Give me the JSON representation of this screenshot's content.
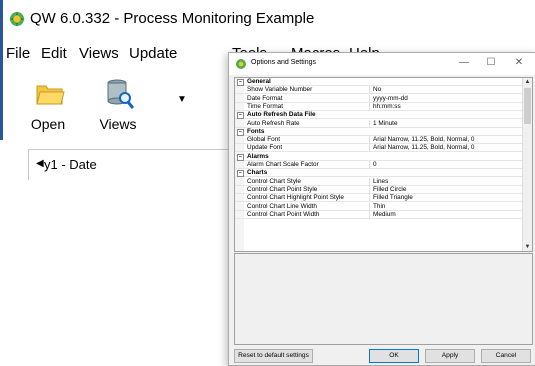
{
  "app": {
    "title": "QW 6.0.332 - Process Monitoring Example",
    "menu": [
      "File",
      "Edit",
      "Views",
      "Update",
      "Tools",
      "Macros",
      "Help"
    ],
    "ribbon": {
      "open_label": "Open",
      "views_label": "Views"
    },
    "tree": {
      "item_label": "y1 - Date"
    }
  },
  "dialog": {
    "title": "Options and Settings",
    "window_controls": {
      "minimize": "—",
      "maximize": "☐",
      "close": "✕"
    },
    "rows": [
      {
        "type": "category",
        "name": "General"
      },
      {
        "type": "property",
        "name": "Show Variable Number",
        "value": "No"
      },
      {
        "type": "property",
        "name": "Date Format",
        "value": "yyyy-mm-dd"
      },
      {
        "type": "property",
        "name": "Time Format",
        "value": "hh:mm:ss"
      },
      {
        "type": "category",
        "name": "Auto Refresh Data File"
      },
      {
        "type": "property",
        "name": "Auto Refresh Rate",
        "value": "1 Minute"
      },
      {
        "type": "category",
        "name": "Fonts"
      },
      {
        "type": "property",
        "name": "Global Font",
        "value": "Arial Narrow, 11.25, Bold, Normal, 0"
      },
      {
        "type": "property",
        "name": "Update Font",
        "value": "Arial Narrow, 11.25, Bold, Normal, 0"
      },
      {
        "type": "category",
        "name": "Alarms"
      },
      {
        "type": "property",
        "name": "Alarm Chart Scale Factor",
        "value": "0"
      },
      {
        "type": "category",
        "name": "Charts"
      },
      {
        "type": "property",
        "name": "Control Chart Style",
        "value": "Lines"
      },
      {
        "type": "property",
        "name": "Control Chart Point Style",
        "value": "Filled Circle"
      },
      {
        "type": "property",
        "name": "Control Chart Highlight Point Style",
        "value": "Filled Triangle"
      },
      {
        "type": "property",
        "name": "Control Chart Line Width",
        "value": "Thin"
      },
      {
        "type": "property",
        "name": "Control Chart Point Width",
        "value": "Medium"
      }
    ],
    "buttons": {
      "reset": "Reset to default settings",
      "ok": "OK",
      "apply": "Apply",
      "cancel": "Cancel"
    }
  },
  "colors": {
    "accent": "#2b579a",
    "focus_border": "#0078d7"
  }
}
